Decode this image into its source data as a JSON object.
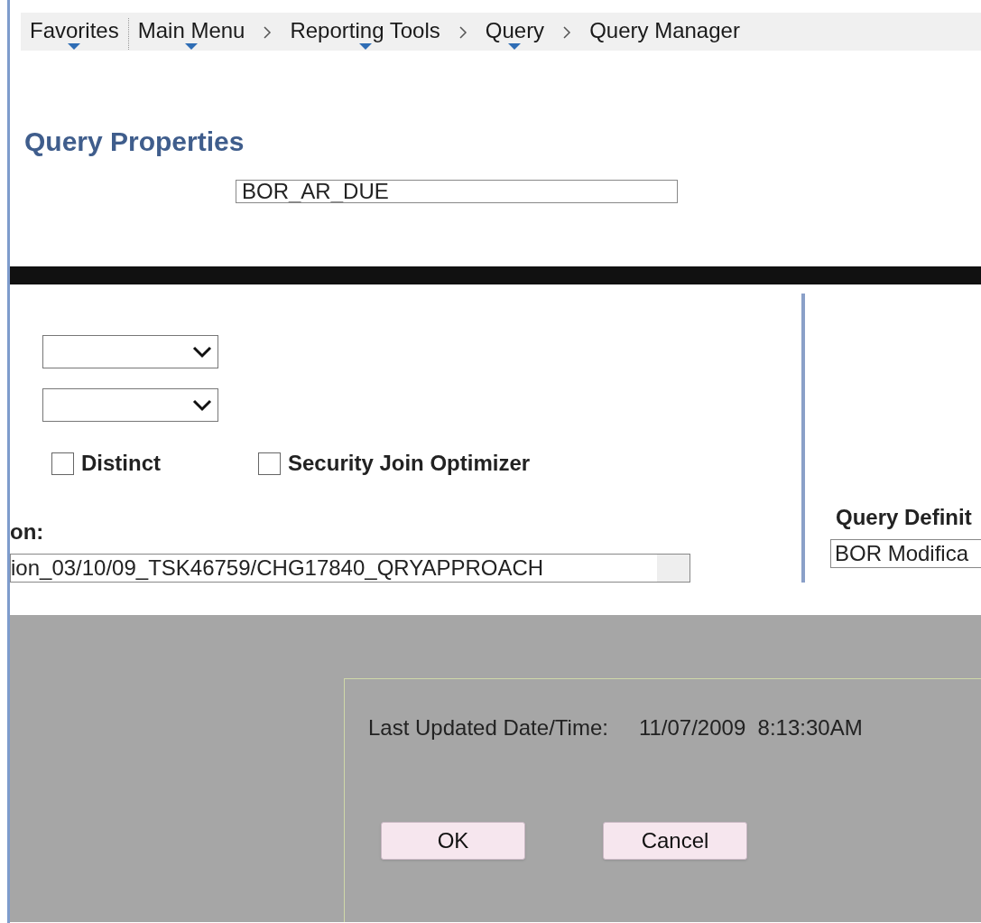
{
  "breadcrumb": [
    {
      "label": "Favorites",
      "menu": true,
      "separator": false
    },
    {
      "label": "Main Menu",
      "menu": true,
      "separator": true
    },
    {
      "label": "Reporting Tools",
      "menu": true,
      "separator": true
    },
    {
      "label": "Query",
      "menu": true,
      "separator": true
    },
    {
      "label": "Query Manager",
      "menu": false,
      "separator": false
    }
  ],
  "title": "Query Properties",
  "query_field": {
    "value": "BOR_AR_DUE"
  },
  "dropdowns": [
    {
      "kind": "select"
    },
    {
      "kind": "select"
    }
  ],
  "checkboxes": [
    {
      "label": "Distinct",
      "checked": false
    },
    {
      "label": "Security Join Optimizer",
      "checked": false
    }
  ],
  "description": {
    "label": "on:",
    "value": "ion_03/10/09_TSK46759/CHG17840_QRYAPPROACH"
  },
  "query_definition": {
    "label": "Query Definit",
    "value": "BOR Modifica"
  },
  "dialog": {
    "label": "Last Updated Date/Time:",
    "value": "11/07/2009  8:13:30AM",
    "buttons": [
      "OK",
      "Cancel"
    ]
  }
}
